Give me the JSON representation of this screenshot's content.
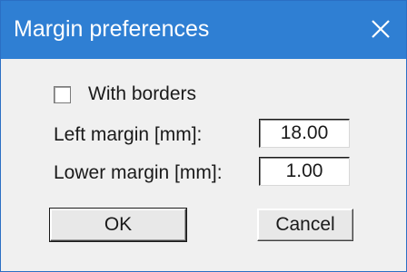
{
  "window": {
    "title": "Margin preferences",
    "close_icon": "close-icon"
  },
  "form": {
    "borders_label": "With borders",
    "borders_checked": false,
    "left_margin_label": "Left margin [mm]:",
    "left_margin_value": "18.00",
    "lower_margin_label": "Lower margin [mm]:",
    "lower_margin_value": "1.00"
  },
  "buttons": {
    "ok_label": "OK",
    "cancel_label": "Cancel"
  },
  "colors": {
    "titlebar": "#2f7fd3",
    "dialog_bg": "#f0f0f0"
  }
}
